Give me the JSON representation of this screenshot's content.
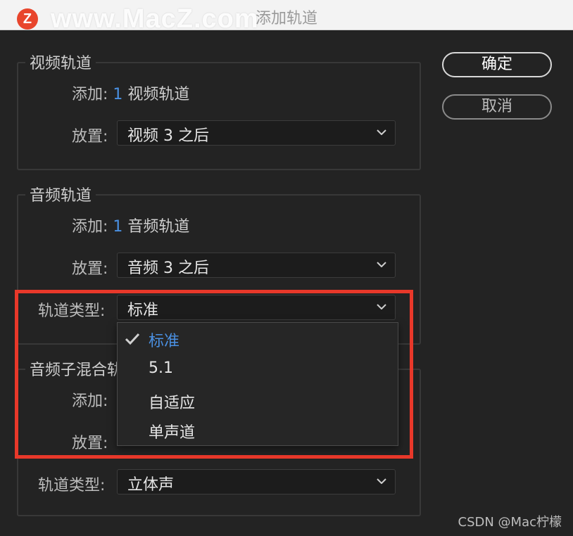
{
  "window": {
    "title": "添加轨道",
    "watermark_logo": "Z",
    "watermark_text": "www.MacZ.com"
  },
  "buttons": {
    "ok": "确定",
    "cancel": "取消"
  },
  "video_tracks": {
    "title": "视频轨道",
    "add_label": "添加:",
    "add_count": "1",
    "add_unit": "视频轨道",
    "place_label": "放置:",
    "place_value": "视频 3 之后"
  },
  "audio_tracks": {
    "title": "音频轨道",
    "add_label": "添加:",
    "add_count": "1",
    "add_unit": "音频轨道",
    "place_label": "放置:",
    "place_value": "音频 3 之后",
    "type_label": "轨道类型:",
    "type_value": "标准"
  },
  "dropdown": {
    "options": [
      "标准",
      "5.1",
      "自适应",
      "单声道"
    ],
    "selected": "标准"
  },
  "audio_submix": {
    "title": "音频子混合轨",
    "add_label": "添加:",
    "place_label": "放置:",
    "type_label": "轨道类型:",
    "type_value": "立体声"
  },
  "credit": "CSDN @Mac柠檬",
  "colors": {
    "background": "#232323",
    "accent_blue": "#4a90e2",
    "highlight_red": "#e8382a"
  },
  "icons": {
    "dropdown_arrow": "chevron-down-icon",
    "selected_mark": "checkmark-icon"
  }
}
